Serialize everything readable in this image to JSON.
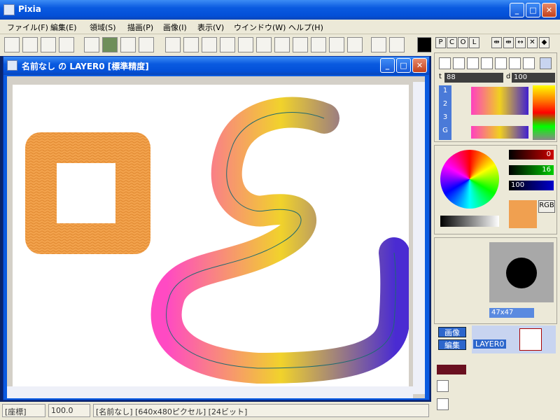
{
  "app": {
    "title": "Pixia"
  },
  "menu": [
    "ファイル(F)",
    "編集(E)",
    "領域(S)",
    "描画(P)",
    "画像(I)",
    "表示(V)",
    "ウインドウ(W)",
    "ヘルプ(H)"
  ],
  "doc": {
    "title": "名前なし の LAYER0 [標準精度]"
  },
  "status": {
    "coord_label": "[座標]",
    "zoom": "100.0",
    "info": "[名前なし] [640x480ピクセル] [24ビット]"
  },
  "panel": {
    "mode_tabs": [
      "P",
      "C",
      "O",
      "L"
    ],
    "thickness_label": "t",
    "thickness": "88",
    "density_label": "d",
    "density": "100",
    "layer_nums": [
      "1",
      "2",
      "3",
      "G"
    ],
    "rgb": {
      "r": "0",
      "g": "16",
      "b": "100"
    },
    "rgb_button": "RGB",
    "brush_size": "47x47",
    "image_tab": "画像",
    "edit_tab": "編集",
    "layer_name": "LAYER0"
  },
  "colors": {
    "accent": "#0a5ae0",
    "brush_orange": "#f0a050",
    "curve_blue": "#4020d0",
    "curve_pink": "#ff40c0",
    "curve_yellow": "#f0d020"
  }
}
